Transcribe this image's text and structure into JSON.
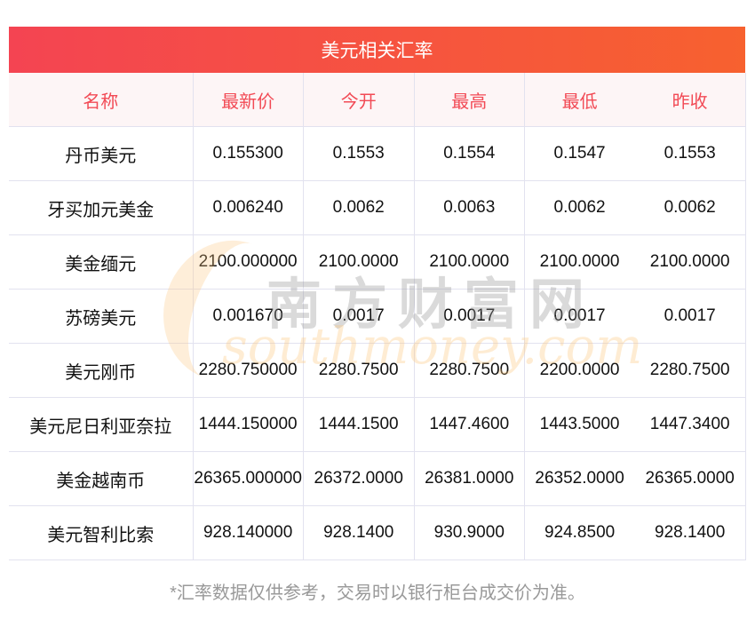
{
  "title": "美元相关汇率",
  "columns": [
    "名称",
    "最新价",
    "今开",
    "最高",
    "最低",
    "昨收"
  ],
  "rows": [
    [
      "丹币美元",
      "0.155300",
      "0.1553",
      "0.1554",
      "0.1547",
      "0.1553"
    ],
    [
      "牙买加元美金",
      "0.006240",
      "0.0062",
      "0.0063",
      "0.0062",
      "0.0062"
    ],
    [
      "美金缅元",
      "2100.000000",
      "2100.0000",
      "2100.0000",
      "2100.0000",
      "2100.0000"
    ],
    [
      "苏磅美元",
      "0.001670",
      "0.0017",
      "0.0017",
      "0.0017",
      "0.0017"
    ],
    [
      "美元刚币",
      "2280.750000",
      "2280.7500",
      "2280.7500",
      "2200.0000",
      "2280.7500"
    ],
    [
      "美元尼日利亚奈拉",
      "1444.150000",
      "1444.1500",
      "1447.4600",
      "1443.5000",
      "1447.3400"
    ],
    [
      "美金越南币",
      "26365.000000",
      "26372.0000",
      "26381.0000",
      "26352.0000",
      "26365.0000"
    ],
    [
      "美元智利比索",
      "928.140000",
      "928.1400",
      "930.9000",
      "924.8500",
      "928.1400"
    ]
  ],
  "watermark": {
    "cn": "南方财富网",
    "en": "southmoney.com"
  },
  "footnote": "*汇率数据仅供参考，交易时以银行柜台成交价为准。"
}
